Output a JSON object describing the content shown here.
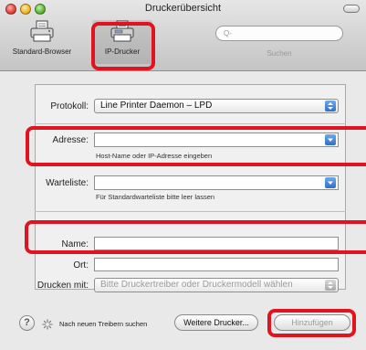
{
  "window": {
    "title": "Druckerübersicht"
  },
  "toolbar": {
    "items": [
      {
        "label": "Standard-Browser",
        "icon": "printer-icon"
      },
      {
        "label": "IP-Drucker",
        "icon": "network-printer-icon",
        "selected": true
      }
    ],
    "search": {
      "placeholder": "Q-",
      "caption": "Suchen"
    }
  },
  "form": {
    "protocol": {
      "label": "Protokoll:",
      "value": "Line Printer Daemon – LPD"
    },
    "address": {
      "label": "Adresse:",
      "value": "",
      "hint": "Host-Name oder IP-Adresse eingeben"
    },
    "queue": {
      "label": "Warteliste:",
      "value": "",
      "hint": "Für Standardwarteliste bitte leer lassen"
    },
    "name": {
      "label": "Name:",
      "value": ""
    },
    "location": {
      "label": "Ort:",
      "value": ""
    },
    "print_using": {
      "label": "Drucken mit:",
      "value": "Bitte Druckertreiber oder Druckermodell wählen"
    }
  },
  "bottom": {
    "help": "?",
    "status": "Nach neuen Treibern suchen",
    "more_printers": "Weitere Drucker...",
    "add": "Hinzufügen"
  },
  "colors": {
    "highlight": "#e0141e",
    "popup_arrow": "#2f6fca"
  }
}
